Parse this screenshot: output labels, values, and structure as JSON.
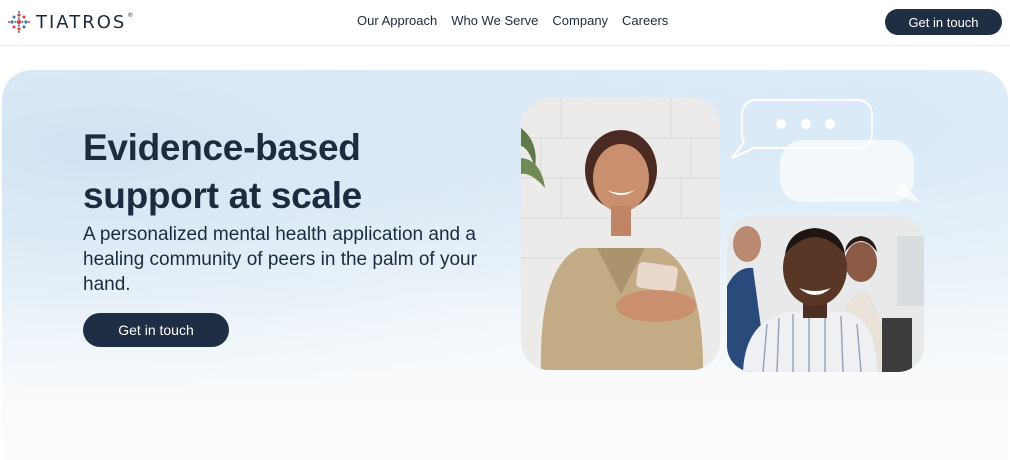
{
  "header": {
    "logo_text": "TIATROS",
    "logo_reg": "®",
    "nav": [
      "Our Approach",
      "Who We Serve",
      "Company",
      "Careers"
    ],
    "cta_label": "Get in touch"
  },
  "hero": {
    "title": "Evidence-based support at scale",
    "subtitle": "A personalized mental health application and a healing community of peers in the palm of your hand.",
    "cta_label": "Get in touch"
  },
  "colors": {
    "brand_dark": "#1f2e45",
    "text": "#1c2b3f",
    "logo_red": "#d9453a",
    "logo_blue": "#3b6fb6"
  },
  "icons": [
    "logo-mark-icon",
    "chat-bubble-icon"
  ]
}
